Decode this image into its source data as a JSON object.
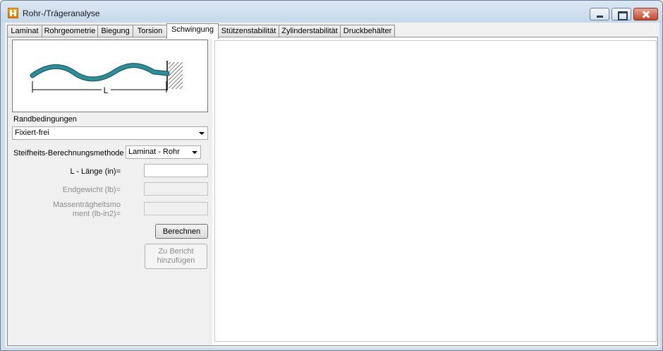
{
  "window": {
    "title": "Rohr-/Trägeranalyse"
  },
  "tabs": [
    {
      "label": "Laminat",
      "active": false
    },
    {
      "label": "Rohrgeometrie",
      "active": false
    },
    {
      "label": "Biegung",
      "active": false
    },
    {
      "label": "Torsion",
      "active": false
    },
    {
      "label": "Schwingung",
      "active": true
    },
    {
      "label": "Stützenstabilität",
      "active": false
    },
    {
      "label": "Zylinderstabilität",
      "active": false
    },
    {
      "label": "Druckbehälter",
      "active": false
    }
  ],
  "illustration": {
    "dimension_label": "L",
    "beam_color": "#2e8f9a"
  },
  "boundary": {
    "label": "Randbedingungen",
    "selected": "Fixiert-frei"
  },
  "stiffness": {
    "label": "Steifheits-Berechnungsmethode",
    "selected": "Laminat - Rohr"
  },
  "inputs": {
    "length_label": "L - Länge (in)=",
    "length_value": "",
    "end_weight_label": "Endgewicht (lb)=",
    "end_weight_value": "",
    "moment_label_line1": "Massenträgheitsmo",
    "moment_label_line2": "ment (lb-in2)=",
    "moment_value": ""
  },
  "buttons": {
    "calculate": "Berechnen",
    "add_report_line1": "Zu Bericht",
    "add_report_line2": "hinzufügen"
  }
}
